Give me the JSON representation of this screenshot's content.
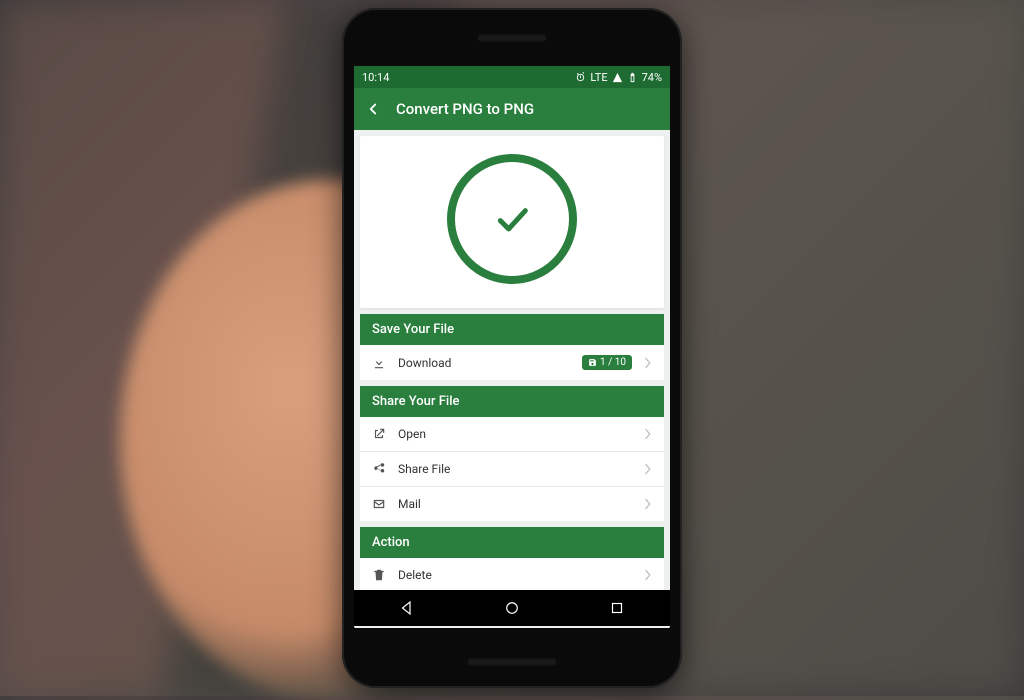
{
  "statusbar": {
    "time": "10:14",
    "network": "LTE",
    "battery": "74%"
  },
  "appbar": {
    "title": "Convert PNG to PNG"
  },
  "sections": {
    "save": {
      "header": "Save Your File",
      "download_label": "Download",
      "badge": "1 / 10"
    },
    "share": {
      "header": "Share Your File",
      "open_label": "Open",
      "share_label": "Share File",
      "mail_label": "Mail"
    },
    "action": {
      "header": "Action",
      "delete_label": "Delete"
    }
  }
}
